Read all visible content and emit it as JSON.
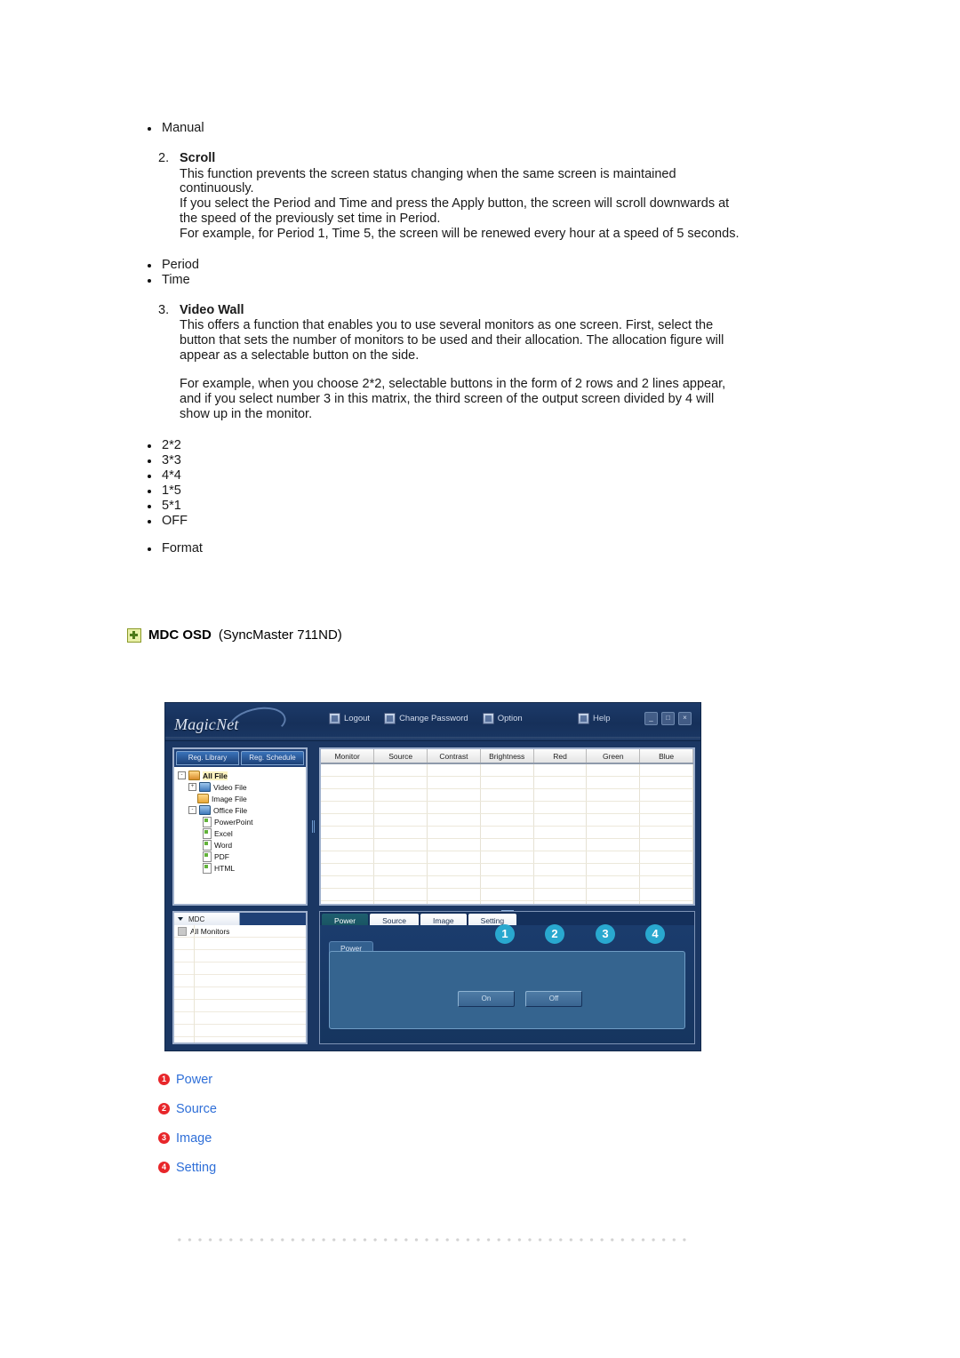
{
  "document": {
    "pre_bullets": [
      "Manual"
    ],
    "section2": {
      "number": "2.",
      "title": "Scroll",
      "paragraphs": [
        "This function prevents the screen status changing when the same screen is maintained continuously.",
        "If you select the Period and Time and press the Apply button, the screen will scroll downwards at the speed of the previously set time in Period.",
        "For example, for Period 1, Time 5, the screen will be renewed every hour at a speed of 5 seconds."
      ]
    },
    "mid_bullets": [
      "Period",
      "Time"
    ],
    "section3": {
      "number": "3.",
      "title": "Video Wall",
      "paragraphs": [
        "This offers a function that enables you to use several monitors as one screen. First, select the button that sets the number of monitors to be used and their allocation. The allocation figure will appear as a selectable button on the side.",
        "For example, when you choose 2*2, selectable buttons in the form of 2 rows and 2 lines appear, and if you select number 3 in this matrix, the third screen of the output screen divided by 4 will show up in the monitor."
      ]
    },
    "wall_bullets": [
      "2*2",
      "3*3",
      "4*4",
      "1*5",
      "5*1",
      "OFF"
    ],
    "post_bullets": [
      "Format"
    ],
    "heading": {
      "icon": "mdc-osd-icon",
      "title": "MDC OSD",
      "subtitle": "(SyncMaster 711ND)"
    }
  },
  "app": {
    "logo": "MagicNet",
    "toolbar": [
      {
        "label": "Logout",
        "icon": "logout-icon"
      },
      {
        "label": "Change Password",
        "icon": "key-icon"
      },
      {
        "label": "Option",
        "icon": "option-icon"
      }
    ],
    "help": {
      "label": "Help",
      "icon": "help-icon"
    },
    "window_buttons": [
      {
        "name": "minimize",
        "glyph": "_"
      },
      {
        "name": "maximize",
        "glyph": "□"
      },
      {
        "name": "close",
        "glyph": "×"
      }
    ],
    "library": {
      "tabs": [
        "Reg. Library",
        "Reg. Schedule"
      ],
      "tree": [
        {
          "label": "All File",
          "level": 1,
          "toggle": "-",
          "icon": "folder-user-icon",
          "selected": true,
          "bold": true
        },
        {
          "label": "Video File",
          "level": 2,
          "toggle": "+",
          "icon": "folder-blue-icon",
          "selected": false,
          "bold": false
        },
        {
          "label": "Image File",
          "level": 2,
          "toggle": "",
          "icon": "folder-image-icon",
          "selected": false,
          "bold": false
        },
        {
          "label": "Office File",
          "level": 2,
          "toggle": "-",
          "icon": "folder-office-icon",
          "selected": false,
          "bold": false
        },
        {
          "label": "PowerPoint",
          "level": 3,
          "toggle": "",
          "icon": "file-icon",
          "selected": false,
          "bold": false
        },
        {
          "label": "Excel",
          "level": 3,
          "toggle": "",
          "icon": "file-icon",
          "selected": false,
          "bold": false
        },
        {
          "label": "Word",
          "level": 3,
          "toggle": "",
          "icon": "file-icon",
          "selected": false,
          "bold": false
        },
        {
          "label": "PDF",
          "level": 3,
          "toggle": "",
          "icon": "file-icon",
          "selected": false,
          "bold": false
        },
        {
          "label": "HTML",
          "level": 3,
          "toggle": "",
          "icon": "file-icon",
          "selected": false,
          "bold": false
        }
      ]
    },
    "monitor_table": {
      "columns": [
        "Monitor",
        "Source",
        "Contrast",
        "Brightness",
        "Red",
        "Green",
        "Blue"
      ],
      "rows": []
    },
    "mdc_panel": {
      "header": "MDC",
      "items": [
        "All Monitors"
      ]
    },
    "control_panel": {
      "tabs": [
        "Power",
        "Source",
        "Image",
        "Setting"
      ],
      "active_tab": "Power",
      "sub_tab": "Power",
      "buttons": [
        "On",
        "Off"
      ],
      "callouts": [
        "1",
        "2",
        "3",
        "4"
      ]
    }
  },
  "legend": {
    "items": [
      {
        "num": "1",
        "label": "Power"
      },
      {
        "num": "2",
        "label": "Source"
      },
      {
        "num": "3",
        "label": "Image"
      },
      {
        "num": "4",
        "label": "Setting"
      }
    ]
  },
  "colors": {
    "callout_blue": "#29a8cf",
    "legend_red": "#e8262a",
    "legend_blue": "#2f6fd8",
    "app_navy": "#1b3763"
  }
}
